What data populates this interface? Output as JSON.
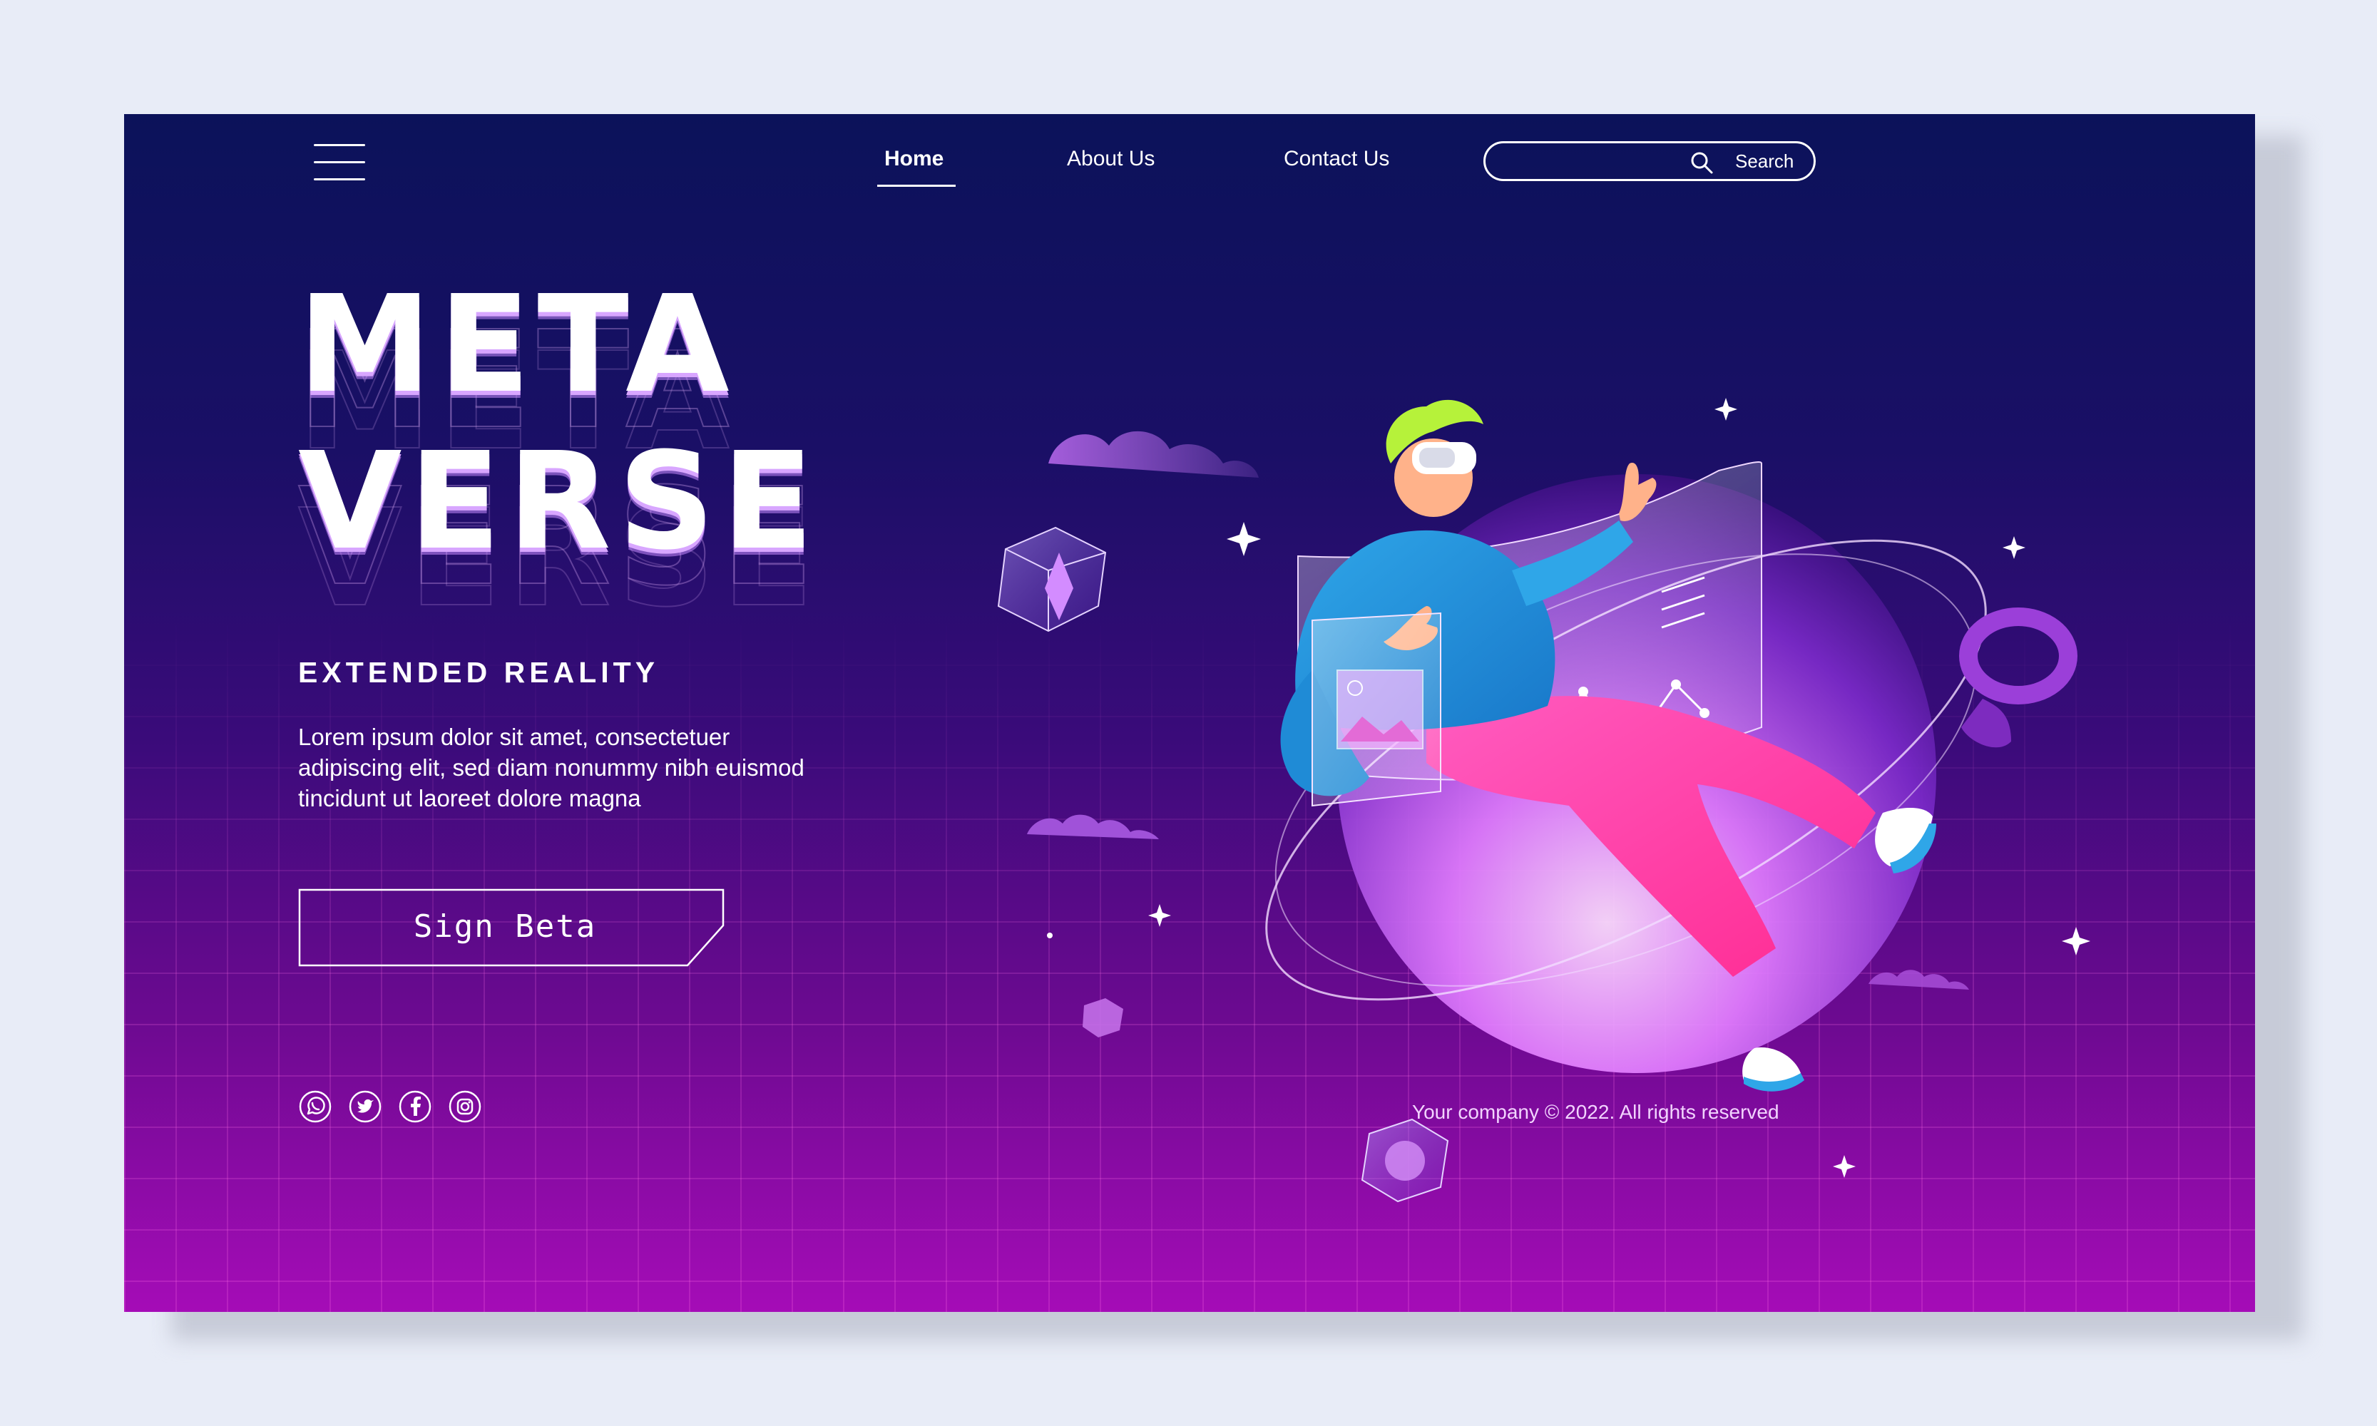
{
  "nav": {
    "home": "Home",
    "about": "About Us",
    "contact": "Contact Us",
    "search_label": "Search",
    "search_placeholder": ""
  },
  "hero": {
    "line1": "META",
    "line2": "VERSE",
    "subtitle": "EXTENDED REALITY",
    "description": "Lorem ipsum dolor sit amet, consectetuer adipiscing elit, sed diam nonummy nibh euismod tincidunt ut laoreet dolore magna",
    "cta": "Sign Beta"
  },
  "social": {
    "icons": [
      "whatsapp-icon",
      "twitter-icon",
      "facebook-icon",
      "instagram-icon"
    ]
  },
  "footer": {
    "copyright": "Your company © 2022. All rights reserved"
  },
  "colors": {
    "bg_top": "#0b125a",
    "bg_bottom": "#a50cb7",
    "accent_pink": "#ff3fa8",
    "accent_blue": "#2fa6e8",
    "accent_lilac": "#c38cff",
    "outer_bg": "#e8ecf7"
  }
}
